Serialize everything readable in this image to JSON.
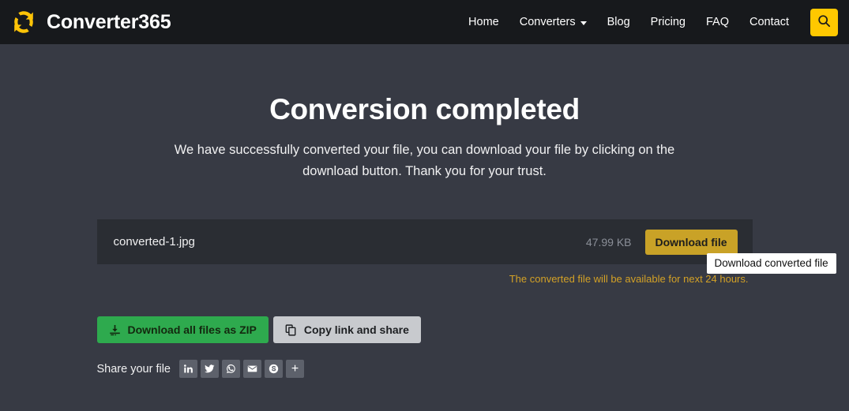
{
  "header": {
    "brand": {
      "name": "Converter365",
      "logo_icon": "refresh-arrows-icon",
      "logo_color": "#ffc407"
    },
    "nav_items": [
      {
        "label": "Home",
        "icon": null
      },
      {
        "label": "Converters",
        "icon": "chevron-down-icon"
      },
      {
        "label": "Blog",
        "icon": null
      },
      {
        "label": "Pricing",
        "icon": null
      },
      {
        "label": "FAQ",
        "icon": null
      },
      {
        "label": "Contact",
        "icon": null
      }
    ],
    "search": {
      "icon": "search-icon",
      "background": "#ffc800"
    },
    "background": "#17191c"
  },
  "main": {
    "title": "Conversion completed",
    "subtitle": "We have successfully converted your file, you can download your file by clicking on the download button. Thank you for your trust.",
    "background": "#373a44",
    "file": {
      "name": "converted-1.jpg",
      "size": "47.99 KB",
      "download_label": "Download file",
      "download_color": "#c9a227",
      "card_background": "#2a2d33"
    },
    "tooltip": {
      "text": "Download converted file",
      "background": "#ffffff",
      "color": "#101010"
    },
    "notice": {
      "text": "The converted file will be available for next 24 hours.",
      "color": "#d3a126"
    },
    "actions": [
      {
        "label": "Download all files as ZIP",
        "icon": "download-tray-icon",
        "background": "#2eaa4e",
        "color": "#13290f"
      },
      {
        "label": "Copy link and share",
        "icon": "copy-pages-icon",
        "background": "#c8cace",
        "color": "#1d1f22"
      }
    ],
    "share": {
      "label": "Share your file",
      "button_background": "#5d616b",
      "buttons": [
        {
          "icon": "linkedin-icon",
          "name": "LinkedIn"
        },
        {
          "icon": "twitter-icon",
          "name": "Twitter"
        },
        {
          "icon": "whatsapp-icon",
          "name": "WhatsApp"
        },
        {
          "icon": "email-icon",
          "name": "Email"
        },
        {
          "icon": "skype-icon",
          "name": "Skype"
        },
        {
          "icon": "plus-icon",
          "name": "More",
          "glyph": "+"
        }
      ]
    }
  }
}
